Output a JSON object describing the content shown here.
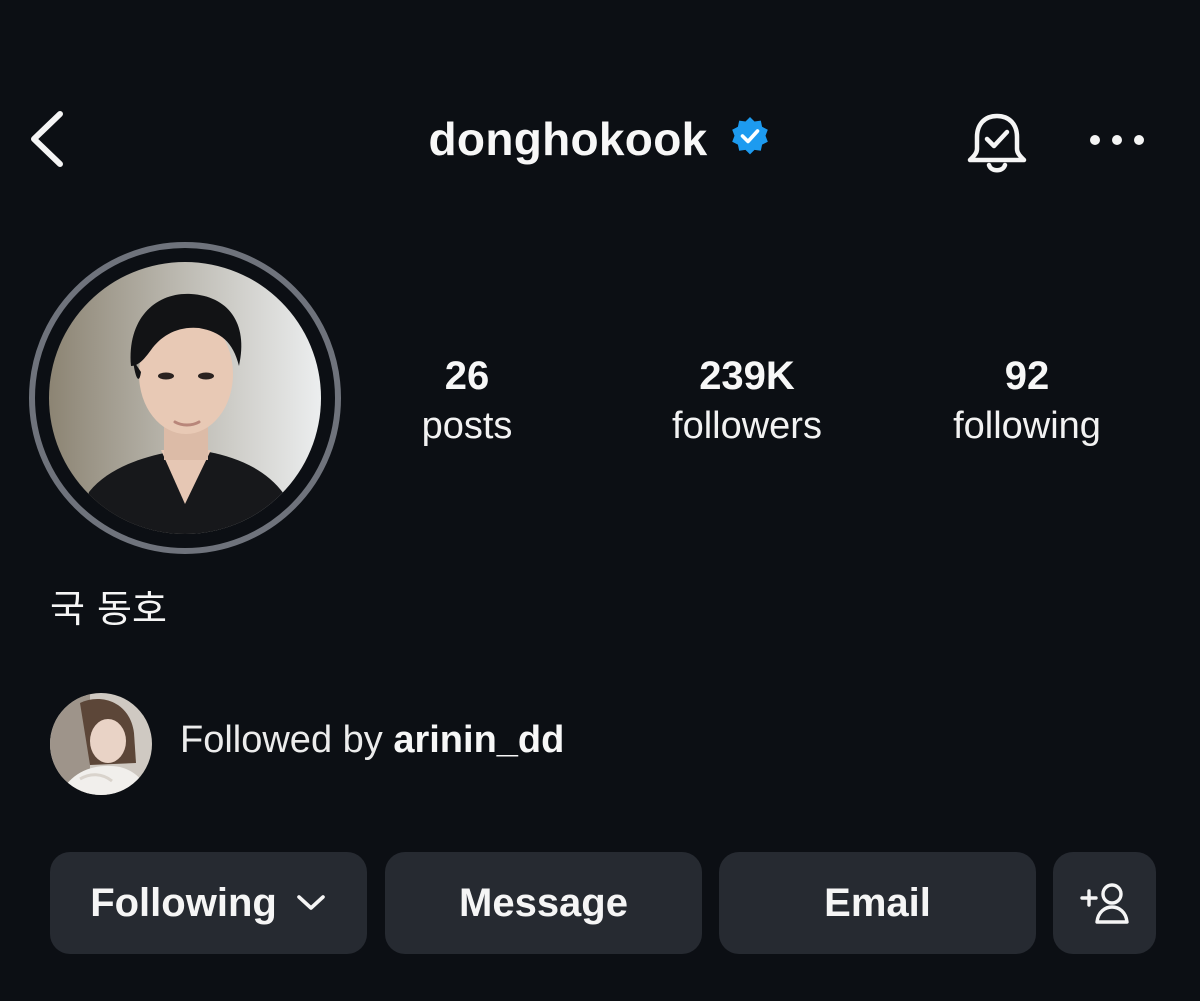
{
  "header": {
    "username": "donghokook",
    "verified": true,
    "icons": {
      "back": "chevron-left-icon",
      "verified": "verified-badge-icon",
      "notifications": "bell-check-icon",
      "more": "more-horizontal-icon"
    }
  },
  "profile": {
    "full_name": "국 동호",
    "stats": {
      "posts": {
        "value": "26",
        "label": "posts"
      },
      "followers": {
        "value": "239K",
        "label": "followers"
      },
      "following": {
        "value": "92",
        "label": "following"
      }
    }
  },
  "mutual": {
    "prefix": "Followed by ",
    "user": "arinin_dd"
  },
  "actions": {
    "following_label": "Following",
    "message_label": "Message",
    "email_label": "Email",
    "add_user_icon": "add-user-icon"
  },
  "colors": {
    "background": "#0c0f14",
    "verified_blue": "#1d9bf0",
    "button_bg": "#262a31",
    "ring": "#6f737c"
  }
}
